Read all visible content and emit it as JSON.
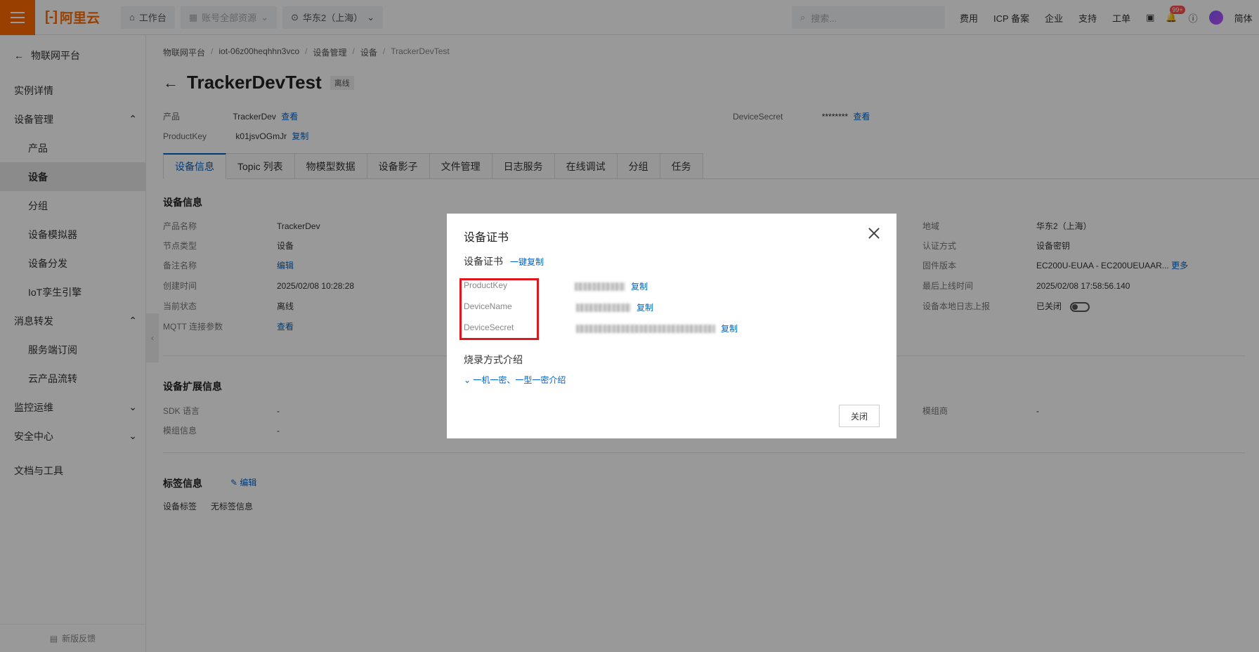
{
  "brand": {
    "logo_text": "阿里云",
    "logo_mark": "[-]"
  },
  "topbar": {
    "workbench": "工作台",
    "resource_scope": "账号全部资源",
    "region": "华东2（上海）",
    "search_placeholder": "搜索...",
    "links": [
      "费用",
      "ICP 备案",
      "企业",
      "支持",
      "工单"
    ],
    "notification_badge": "99+",
    "language": "简体"
  },
  "sidebar": {
    "back_label": "物联网平台",
    "items": [
      {
        "label": "实例详情",
        "level": 1
      },
      {
        "label": "设备管理",
        "level": 1,
        "expanded": true
      },
      {
        "label": "产品",
        "level": 2
      },
      {
        "label": "设备",
        "level": 2,
        "active": true
      },
      {
        "label": "分组",
        "level": 2
      },
      {
        "label": "设备模拟器",
        "level": 2
      },
      {
        "label": "设备分发",
        "level": 2
      },
      {
        "label": "IoT孪生引擎",
        "level": 2
      },
      {
        "label": "消息转发",
        "level": 1,
        "expanded": true
      },
      {
        "label": "服务端订阅",
        "level": 2
      },
      {
        "label": "云产品流转",
        "level": 2
      },
      {
        "label": "监控运维",
        "level": 1,
        "expanded": false
      },
      {
        "label": "安全中心",
        "level": 1,
        "expanded": false
      },
      {
        "label": "文档与工具",
        "level": 1
      }
    ],
    "feedback": "新版反馈"
  },
  "breadcrumb": [
    "物联网平台",
    "iot-06z00heqhhn3vco",
    "设备管理",
    "设备",
    "TrackerDevTest"
  ],
  "device": {
    "name": "TrackerDevTest",
    "status_tag": "离线",
    "product_label": "产品",
    "product_value": "TrackerDev",
    "view": "查看",
    "productkey_label": "ProductKey",
    "productkey_value": "k01jsvOGmJr",
    "copy": "复制",
    "secret_label": "DeviceSecret",
    "secret_value": "********"
  },
  "tabs": [
    "设备信息",
    "Topic 列表",
    "物模型数据",
    "设备影子",
    "文件管理",
    "日志服务",
    "在线调试",
    "分组",
    "任务"
  ],
  "device_info": {
    "title": "设备信息",
    "left": [
      {
        "k": "产品名称",
        "v": "TrackerDev"
      },
      {
        "k": "节点类型",
        "v": "设备"
      },
      {
        "k": "备注名称",
        "v": "编辑",
        "link": true
      },
      {
        "k": "创建时间",
        "v": "2025/02/08 10:28:28"
      },
      {
        "k": "当前状态",
        "v": "离线"
      },
      {
        "k": "MQTT 连接参数",
        "v": "查看",
        "link": true
      }
    ],
    "right": [
      {
        "k": "地域",
        "v": "华东2（上海）"
      },
      {
        "k": "认证方式",
        "v": "设备密钥"
      },
      {
        "k": "固件版本",
        "v": "EC200U-EUAA - EC200UEUAAR...",
        "more": "更多"
      },
      {
        "k": "最后上线时间",
        "v": "2025/02/08 17:58:56.140"
      },
      {
        "k": "设备本地日志上报",
        "v": "已关闭"
      }
    ]
  },
  "ext_info": {
    "title": "设备扩展信息",
    "sdk_label": "SDK 语言",
    "sdk_value": "-",
    "module_label": "模组信息",
    "module_value": "-",
    "vendor_label": "模组商",
    "vendor_value": "-"
  },
  "tag_info": {
    "title": "标签信息",
    "edit": "编辑",
    "tag_label": "设备标签",
    "tag_value": "无标签信息"
  },
  "modal": {
    "title": "设备证书",
    "cert_title": "设备证书",
    "copy_all": "一键复制",
    "rows": [
      {
        "label": "ProductKey",
        "copy": "复制"
      },
      {
        "label": "DeviceName",
        "copy": "复制"
      },
      {
        "label": "DeviceSecret",
        "copy": "复制"
      }
    ],
    "burn_title": "烧录方式介绍",
    "burn_link": "一机一密、一型一密介绍",
    "close": "关闭"
  },
  "colors": {
    "accent": "#ff6a00",
    "link": "#0064c8",
    "highlight": "#e0161c"
  }
}
